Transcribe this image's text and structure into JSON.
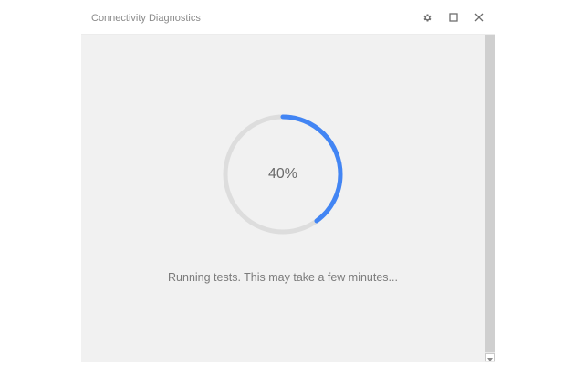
{
  "window": {
    "title": "Connectivity Diagnostics"
  },
  "titlebar": {
    "icons": [
      "gear-icon",
      "maximize-icon",
      "close-icon"
    ]
  },
  "progress": {
    "percent": 40,
    "label": "40%",
    "color": "#4285f4",
    "track_color": "#dddddd"
  },
  "status": {
    "text": "Running tests. This may take a few minutes..."
  }
}
